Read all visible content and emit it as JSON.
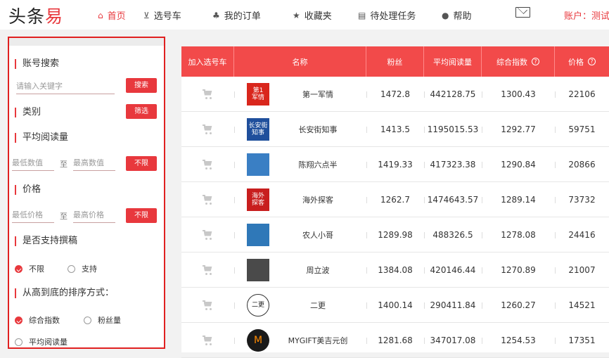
{
  "header": {
    "logo_main": "头条",
    "logo_accent": "易",
    "nav": [
      {
        "icon": "home-icon",
        "glyph": "⌂",
        "label": "首页",
        "active": true
      },
      {
        "icon": "cart-icon",
        "glyph": "⊻",
        "label": "选号车",
        "active": false
      },
      {
        "icon": "order-icon",
        "glyph": "♣",
        "label": "我的订单",
        "active": false
      },
      {
        "icon": "star-icon",
        "glyph": "★",
        "label": "收藏夹",
        "active": false
      },
      {
        "icon": "task-icon",
        "glyph": "▤",
        "label": "待处理任务",
        "active": false
      },
      {
        "icon": "help-icon",
        "glyph": "●",
        "label": "帮助",
        "active": false
      }
    ],
    "account": "账户：测试"
  },
  "sidebar": {
    "keyword_title": "账号搜索",
    "keyword_placeholder": "请输入关键字",
    "search_btn": "搜索",
    "category_title": "类别",
    "filter_btn": "筛选",
    "read_title": "平均阅读量",
    "read_min": "最低数值",
    "read_to": "至",
    "read_max": "最高数值",
    "read_unlimited": "不限",
    "price_title": "价格",
    "price_min": "最低价格",
    "price_to": "至",
    "price_max": "最高价格",
    "price_unlimited": "不限",
    "draft_title": "是否支持撰稿",
    "draft_opt1": "不限",
    "draft_opt2": "支持",
    "sort_title": "从高到底的排序方式：",
    "sort_opt1": "综合指数",
    "sort_opt2": "粉丝量",
    "sort_opt3": "平均阅读量"
  },
  "table": {
    "headers": [
      "加入选号车",
      "名称",
      "粉丝",
      "平均阅读量",
      "综合指数",
      "价格"
    ],
    "rows": [
      {
        "avatar_text": "第1\n军情",
        "avatar_bg": "#d9261c",
        "name": "第一军情",
        "fans": "1472.8",
        "reads": "442128.75",
        "index": "1300.43",
        "price": "22106"
      },
      {
        "avatar_text": "长安街\n知事",
        "avatar_bg": "#1f4f9c",
        "name": "长安街知事",
        "fans": "1413.5",
        "reads": "1195015.53",
        "index": "1292.77",
        "price": "59751"
      },
      {
        "avatar_text": "",
        "avatar_bg": "#3a7fc4",
        "name": "陈翔六点半",
        "fans": "1419.33",
        "reads": "417323.38",
        "index": "1290.84",
        "price": "20866"
      },
      {
        "avatar_text": "海外\n探客",
        "avatar_bg": "#c81e1e",
        "name": "海外探客",
        "fans": "1262.7",
        "reads": "1474643.57",
        "index": "1289.14",
        "price": "73732"
      },
      {
        "avatar_text": "",
        "avatar_bg": "#2f78b8",
        "name": "农人小哥",
        "fans": "1289.98",
        "reads": "488326.5",
        "index": "1278.08",
        "price": "24416"
      },
      {
        "avatar_text": "",
        "avatar_bg": "#4a4a4a",
        "name": "周立波",
        "fans": "1384.08",
        "reads": "420146.44",
        "index": "1270.89",
        "price": "21007"
      },
      {
        "avatar_text": "二更",
        "avatar_bg": "#ffffff",
        "name": "二更",
        "fans": "1400.14",
        "reads": "290411.84",
        "index": "1260.27",
        "price": "14521"
      },
      {
        "avatar_text": "M",
        "avatar_bg": "#1a1a1a",
        "name": "MYGIFT美吉元创",
        "fans": "1281.68",
        "reads": "347017.08",
        "index": "1254.53",
        "price": "17351"
      }
    ]
  }
}
